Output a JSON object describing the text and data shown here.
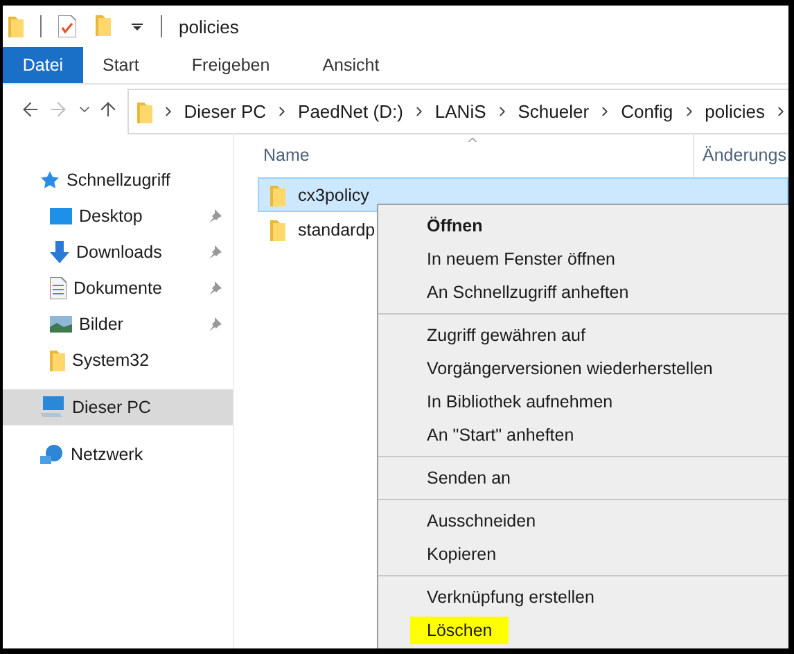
{
  "title_bar": {
    "title": "policies"
  },
  "ribbon_tabs": [
    {
      "label": "Datei",
      "selected": true
    },
    {
      "label": "Start",
      "selected": false
    },
    {
      "label": "Freigeben",
      "selected": false
    },
    {
      "label": "Ansicht",
      "selected": false
    }
  ],
  "nav_buttons": [
    {
      "kind": "back",
      "disabled": false
    },
    {
      "kind": "forward",
      "disabled": true
    },
    {
      "kind": "recent",
      "disabled": false
    },
    {
      "kind": "up",
      "disabled": false
    }
  ],
  "address": {
    "segments": [
      "Dieser PC",
      "PaedNet (D:)",
      "LANiS",
      "Schueler",
      "Config",
      "policies"
    ]
  },
  "sidebar": {
    "items": [
      {
        "label": "Schnellzugriff",
        "kind": "star",
        "selected": false,
        "children": [
          {
            "label": "Desktop",
            "kind": "desktop",
            "pinned": true,
            "selected": false
          },
          {
            "label": "Downloads",
            "kind": "download",
            "pinned": true,
            "selected": false
          },
          {
            "label": "Dokumente",
            "kind": "document",
            "pinned": true,
            "selected": false
          },
          {
            "label": "Bilder",
            "kind": "pictures",
            "pinned": true,
            "selected": false
          },
          {
            "label": "System32",
            "kind": "folder",
            "pinned": false,
            "selected": false
          }
        ]
      },
      {
        "label": "Dieser PC",
        "kind": "pc",
        "selected": true
      },
      {
        "label": "Netzwerk",
        "kind": "network",
        "selected": false
      }
    ]
  },
  "columns": [
    "Name",
    "Änderungs"
  ],
  "files": [
    {
      "name": "cx3policy",
      "selected": true
    },
    {
      "name": "standardp",
      "selected": false
    }
  ],
  "context_menu": {
    "groups": [
      [
        {
          "label": "Öffnen",
          "default": true,
          "highlighted": false
        },
        {
          "label": "In neuem Fenster öffnen",
          "default": false,
          "highlighted": false
        },
        {
          "label": "An Schnellzugriff anheften",
          "default": false,
          "highlighted": false
        }
      ],
      [
        {
          "label": "Zugriff gewähren auf",
          "default": false,
          "highlighted": false
        },
        {
          "label": "Vorgängerversionen wiederherstellen",
          "default": false,
          "highlighted": false
        },
        {
          "label": "In Bibliothek aufnehmen",
          "default": false,
          "highlighted": false
        },
        {
          "label": "An \"Start\" anheften",
          "default": false,
          "highlighted": false
        }
      ],
      [
        {
          "label": "Senden an",
          "default": false,
          "highlighted": false
        }
      ],
      [
        {
          "label": "Ausschneiden",
          "default": false,
          "highlighted": false
        },
        {
          "label": "Kopieren",
          "default": false,
          "highlighted": false
        }
      ],
      [
        {
          "label": "Verknüpfung erstellen",
          "default": false,
          "highlighted": false
        },
        {
          "label": "Löschen",
          "default": false,
          "highlighted": true
        }
      ]
    ]
  }
}
